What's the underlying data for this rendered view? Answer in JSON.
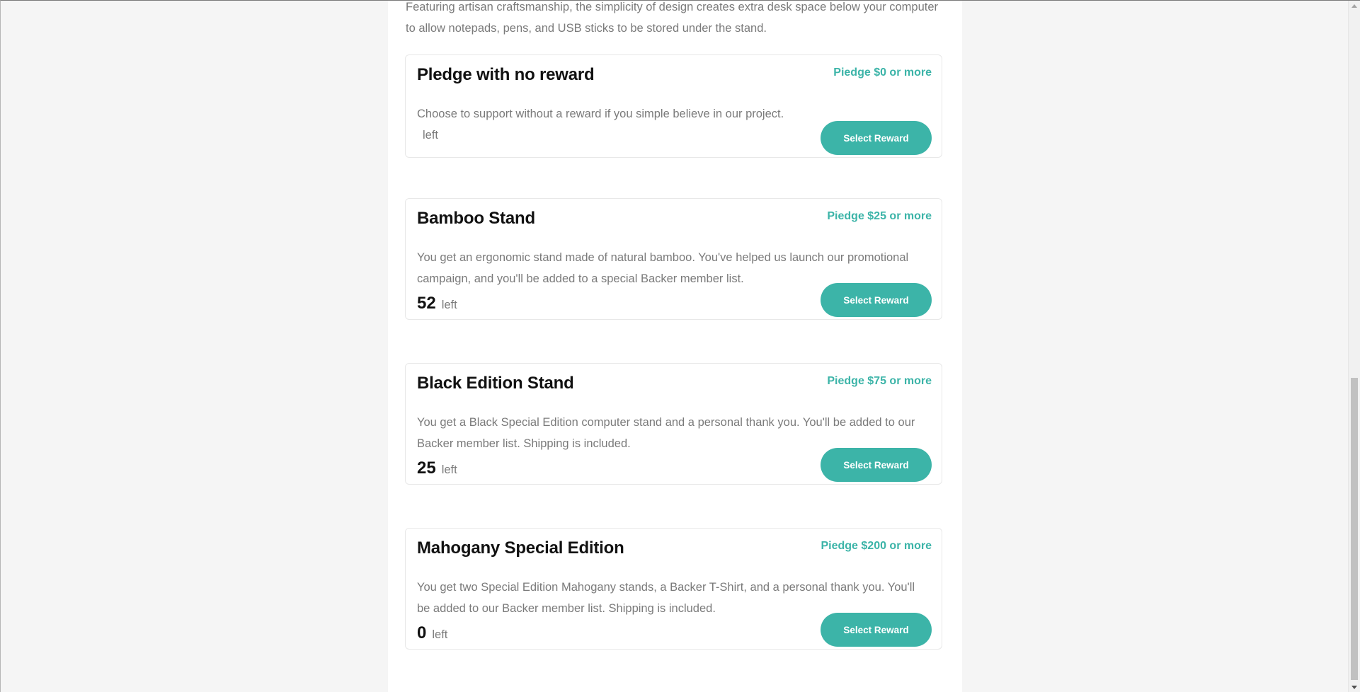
{
  "intro": {
    "text": "Featuring artisan craftsmanship, the simplicity of design creates extra desk space below your computer to allow notepads, pens, and USB sticks to be stored under the stand."
  },
  "rewards": [
    {
      "title": "Pledge with no reward",
      "pledge": "Piedge $0 or more",
      "description": "Choose to support without a reward if you simple believe in our project.",
      "count": "",
      "left_label": "left",
      "button_label": "Select Reward"
    },
    {
      "title": "Bamboo Stand",
      "pledge": "Piedge $25 or more",
      "description": "You get an ergonomic stand made of natural bamboo. You've helped us launch our promotional campaign, and you'll be added to a special Backer member list.",
      "count": "52",
      "left_label": "left",
      "button_label": "Select Reward"
    },
    {
      "title": "Black Edition Stand",
      "pledge": "Piedge $75 or more",
      "description": "You get a Black Special Edition computer stand and a personal thank you. You'll be added to our Backer member list. Shipping is included.",
      "count": "25",
      "left_label": "left",
      "button_label": "Select Reward"
    },
    {
      "title": "Mahogany Special Edition",
      "pledge": "Piedge $200 or more",
      "description": "You get two Special Edition Mahogany stands, a Backer T-Shirt, and a personal thank you. You'll be added to our Backer member list. Shipping is included.",
      "count": "0",
      "left_label": "left",
      "button_label": "Select Reward"
    }
  ],
  "colors": {
    "accent": "#3cb4a8",
    "heading": "#111111",
    "body_text": "#7a7a7a",
    "page_background": "#f5f5f5",
    "card_border": "#e8e8e8"
  }
}
